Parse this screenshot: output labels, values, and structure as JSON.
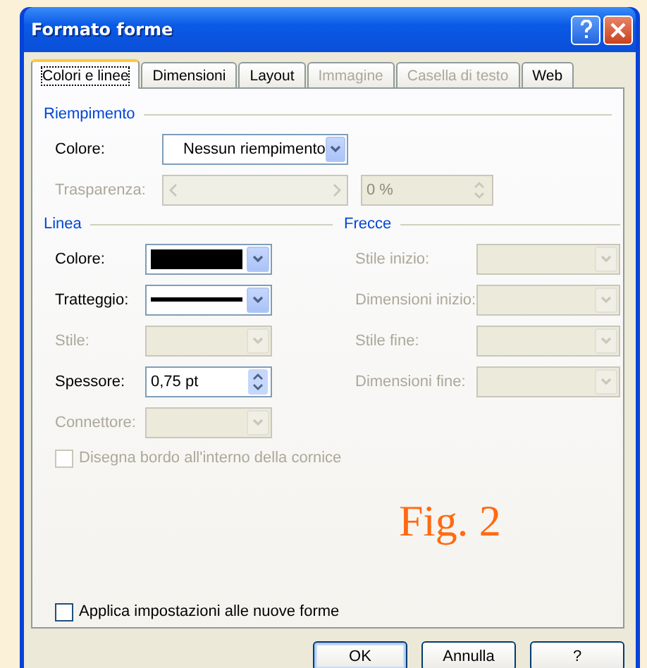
{
  "window": {
    "title": "Formato forme"
  },
  "tabs": [
    {
      "label": "Colori e linee",
      "selected": true,
      "disabled": false
    },
    {
      "label": "Dimensioni",
      "selected": false,
      "disabled": false
    },
    {
      "label": "Layout",
      "selected": false,
      "disabled": false
    },
    {
      "label": "Immagine",
      "selected": false,
      "disabled": true
    },
    {
      "label": "Casella di testo",
      "selected": false,
      "disabled": true
    },
    {
      "label": "Web",
      "selected": false,
      "disabled": false
    }
  ],
  "fill": {
    "title": "Riempimento",
    "rows": [
      {
        "kind": "combo",
        "label": "Colore:",
        "value": "Nessun riempimento",
        "disabled": false
      },
      {
        "kind": "slider",
        "label": "Trasparenza:",
        "value": "0 %",
        "disabled": true
      }
    ]
  },
  "line": {
    "title": "Linea",
    "rows": [
      {
        "kind": "swatch",
        "label": "Colore:",
        "color": "#000000",
        "disabled": false
      },
      {
        "kind": "dash",
        "label": "Tratteggio:",
        "disabled": false
      },
      {
        "kind": "combo",
        "label": "Stile:",
        "disabled": true
      },
      {
        "kind": "spin",
        "label": "Spessore:",
        "value": "0,75 pt",
        "disabled": false
      },
      {
        "kind": "combo",
        "label": "Connettore:",
        "disabled": true
      }
    ]
  },
  "arrows": {
    "title": "Frecce",
    "rows": [
      {
        "kind": "combo",
        "label": "Stile inizio:",
        "disabled": true
      },
      {
        "kind": "combo",
        "label": "Dimensioni inizio:",
        "disabled": true
      },
      {
        "kind": "combo",
        "label": "Stile fine:",
        "disabled": true
      },
      {
        "kind": "combo",
        "label": "Dimensioni fine:",
        "disabled": true
      }
    ]
  },
  "inner_border": {
    "label": "Disegna bordo all'interno della cornice",
    "checked": false,
    "disabled": true
  },
  "annotation": "Fig. 2",
  "apply_default": {
    "label": "Applica impostazioni alle nuove forme",
    "checked": false,
    "disabled": false
  },
  "buttons": [
    {
      "label": "OK",
      "default": true
    },
    {
      "label": "Annulla",
      "default": false
    },
    {
      "label": "?",
      "default": false
    }
  ]
}
